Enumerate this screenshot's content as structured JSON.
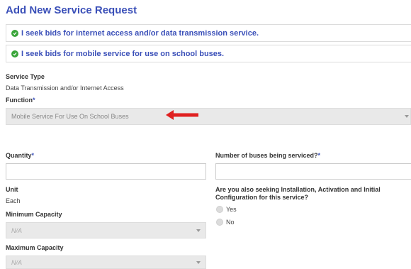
{
  "page_title": "Add New Service Request",
  "options": [
    "I seek bids for internet access and/or data transmission service.",
    "I seek bids for mobile service for use on school buses."
  ],
  "service_type": {
    "label": "Service Type",
    "value": "Data Transmission and/or Internet Access"
  },
  "function": {
    "label": "Function",
    "required_marker": "*",
    "selected": "Mobile Service For Use On School Buses"
  },
  "quantity": {
    "label": "Quantity",
    "required_marker": "*",
    "value": ""
  },
  "buses": {
    "label": "Number of buses being serviced?",
    "required_marker": "*",
    "value": ""
  },
  "unit": {
    "label": "Unit",
    "value": "Each"
  },
  "installation": {
    "label_line1": "Are you also seeking Installation, Activation and Initial",
    "label_line2": "Configuration for this service?",
    "options": [
      "Yes",
      "No"
    ]
  },
  "min_capacity": {
    "label": "Minimum Capacity",
    "selected": "N/A"
  },
  "max_capacity": {
    "label": "Maximum Capacity",
    "selected": "N/A"
  },
  "colors": {
    "accent": "#3a4fb8",
    "check_green": "#3aa53a",
    "arrow_red": "#e02020"
  },
  "icons": {
    "option": "check-circle-icon",
    "pointer": "red-arrow-icon",
    "dropdown": "caret-down-icon"
  }
}
